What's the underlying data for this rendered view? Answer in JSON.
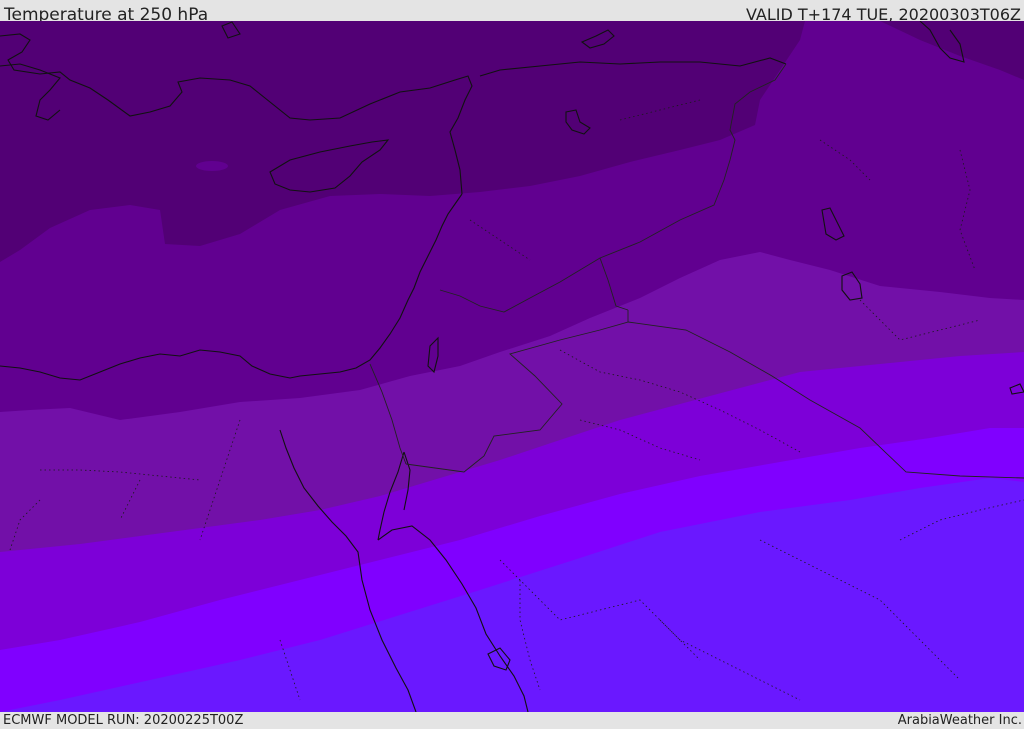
{
  "header": {
    "title": "Temperature at 250 hPa",
    "valid": "VALID T+174 TUE, 20200303T06Z"
  },
  "footer": {
    "model_run": "ECMWF MODEL RUN: 20200225T00Z",
    "brand": "ArabiaWeather Inc."
  },
  "map": {
    "colors": {
      "band_1_coldest": "#520075",
      "band_2": "#610090",
      "band_3": "#7210a8",
      "band_4": "#7d00d8",
      "band_5": "#8000ff",
      "band_6_warmest": "#6a18ff",
      "coastline": "#111111",
      "border": "#222222"
    }
  }
}
